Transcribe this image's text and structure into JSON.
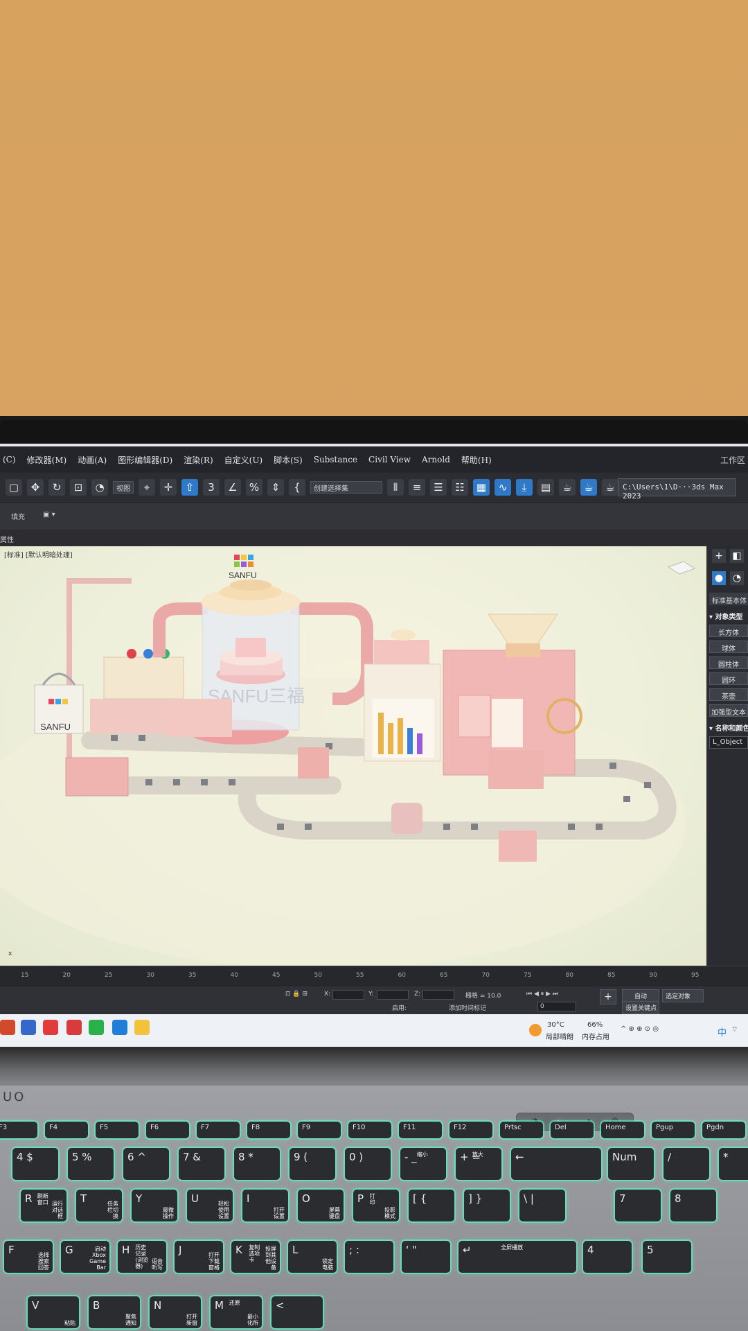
{
  "app": {
    "menu_items": [
      "(C)",
      "修改器(M)",
      "动画(A)",
      "图形编辑器(D)",
      "渲染(R)",
      "自定义(U)",
      "脚本(S)",
      "Substance",
      "Civil View",
      "Arnold",
      "帮助(H)"
    ],
    "workspace_label": "工作区",
    "view_dropdown": "视图",
    "selection_set": "创建选择集",
    "toolbar_numbers": "3",
    "project_path": "C:\\Users\\1\\D···3ds Max 2023",
    "ribbon_fill": "填充",
    "properties_label": "属性",
    "viewport_label": "[标准] [默认明暗处理]",
    "scene_brand": "SANFU",
    "scene_banner": "SANFU三福"
  },
  "command_panel": {
    "dropdown": "标准基本体",
    "object_type_header": "▾ 对象类型",
    "buttons": [
      "长方体",
      "球体",
      "圆柱体",
      "圆环",
      "茶壶",
      "加强型文本"
    ],
    "name_color_header": "▾ 名称和颜色",
    "object_name": "L_Object"
  },
  "timeline": {
    "ticks": [
      "15",
      "20",
      "25",
      "30",
      "35",
      "40",
      "45",
      "50",
      "55",
      "60",
      "65",
      "70",
      "75",
      "80",
      "85",
      "90",
      "95"
    ]
  },
  "status": {
    "x_label": "X:",
    "y_label": "Y:",
    "z_label": "Z:",
    "grid": "栅格 = 10.0",
    "enable": "启用:",
    "add_time_tag": "添加时间标记",
    "auto_key": "自动",
    "set_key": "设置关键点",
    "selected_object": "选定对象",
    "frame_value": "0"
  },
  "taskbar": {
    "weather_temp": "30°C",
    "weather_desc": "局部晴朗",
    "memory_pct": "66%",
    "memory_label": "内存占用",
    "ime_label": "中"
  },
  "laptop": {
    "brand": "UO",
    "fn_keys": [
      "F3",
      "F4",
      "F5",
      "F6",
      "F7",
      "F8",
      "F9",
      "F10",
      "F11",
      "F12",
      "Prtsc",
      "Del",
      "Home",
      "Pgup",
      "Pgdn"
    ],
    "num_row": [
      "4 $",
      "5 %",
      "6 ^",
      "7 &",
      "8 *",
      "9 (",
      "0 )",
      "- _",
      "+ =",
      "←",
      "Num",
      "/",
      "*"
    ],
    "row_r": [
      "R",
      "T",
      "Y",
      "U",
      "I",
      "O",
      "P",
      "[ {",
      "] }",
      "\\ |",
      "7",
      "8"
    ],
    "row_f": [
      "F",
      "G",
      "H",
      "J",
      "K",
      "L",
      "; :",
      "' \"",
      "↵",
      "4",
      "5"
    ],
    "row_v": [
      "V",
      "B",
      "N",
      "M",
      "<"
    ],
    "sublabels": {
      "R": "运行\n对话\n框",
      "T": "任务\n栏切\n换",
      "Y": "最微\n操作",
      "U": "轻松\n使用\n设置",
      "I": "打开\n设置",
      "O": "屏幕\n键盘",
      "P": "投影\n模式",
      "F": "选择\n搜索\n回答",
      "G": "启动\nXbox\nGame\nBar",
      "H": "语音\n听写",
      "J": "打开\n下载\n窗格",
      "K": "投屏\n到其\n他设\n备",
      "L": "锁定\n电脑",
      "V": "粘贴",
      "B": "聚焦\n通知",
      "N": "打开\n新窗",
      "M": "最小\n化所"
    },
    "key_tags": {
      "r_extra": "刷新\n窗口",
      "p_extra": "打\n印",
      "minus": "缩小",
      "plus": "放大",
      "h_extra": "历史\n记录\n(浏览\n器)",
      "k_extra": "复制\n选项\n卡",
      "t_extra": "我的\n电脑",
      "enter_tag": "全屏播放",
      "m_extra": "还原"
    }
  }
}
